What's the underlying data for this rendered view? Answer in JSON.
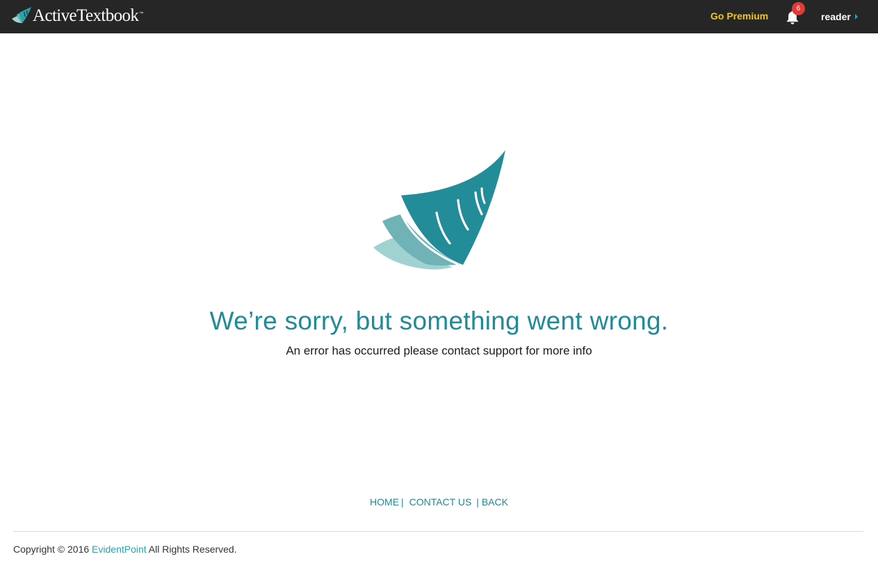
{
  "header": {
    "brand": "ActiveTextbook",
    "brand_tm": "™",
    "go_premium": "Go Premium",
    "notification_count": "6",
    "user_name": "reader",
    "colors": {
      "bar_background": "#262626",
      "premium": "#f5c518",
      "badge": "#e53935",
      "accent": "#2aa1ad"
    }
  },
  "error": {
    "title": "We’re sorry, but something went wrong.",
    "message": "An error has occurred please contact support for more info",
    "colors": {
      "title": "#1f8a98",
      "illustration_dark": "#238c99",
      "illustration_mid": "#6fb3b6",
      "illustration_light": "#9fd2d1"
    }
  },
  "footer": {
    "links": {
      "home": "HOME",
      "contact": "CONTACT US",
      "back": "BACK",
      "separator": "|"
    },
    "copyright_prefix": "Copyright © 2016",
    "company": "EvidentPoint",
    "copyright_suffix": "All Rights Reserved."
  },
  "icons": [
    "activetextbook-logo-icon",
    "bell-icon",
    "caret-right-icon",
    "book-pages-illustration"
  ]
}
